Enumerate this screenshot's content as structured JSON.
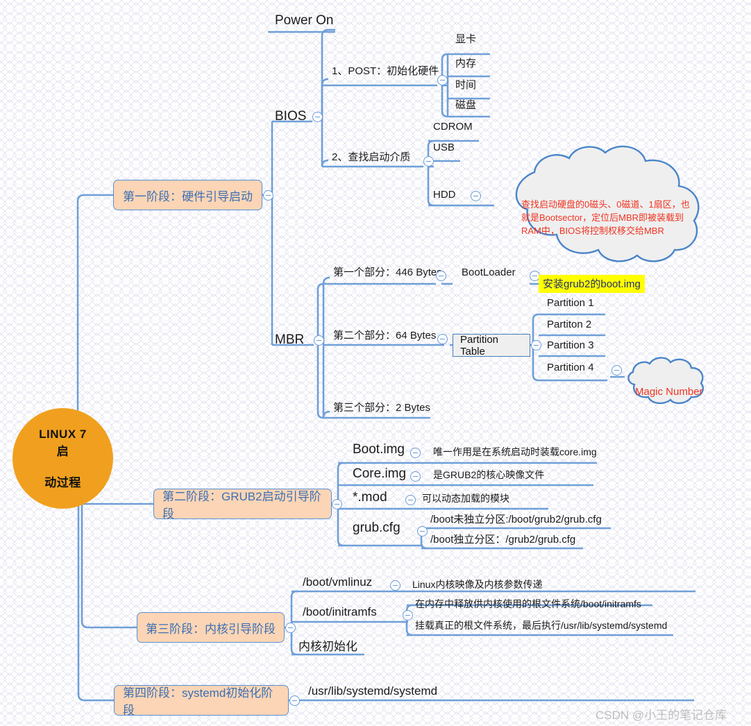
{
  "central": {
    "line1": "LINUX 7 启",
    "line2": "动过程"
  },
  "stages": [
    {
      "label": "第一阶段：硬件引导启动"
    },
    {
      "label": "第二阶段：GRUB2启动引导阶段"
    },
    {
      "label": "第三阶段：内核引导阶段"
    },
    {
      "label": "第四阶段：systemd初始化阶段"
    }
  ],
  "stage1": {
    "power_on": "Power On",
    "bios": "BIOS",
    "post": "1、POST：初始化硬件",
    "post_items": [
      "显卡",
      "内存",
      "时间",
      "磁盘"
    ],
    "find_media": "2、查找启动介质",
    "media_items": [
      "CDROM",
      "USB",
      "HDD"
    ],
    "hdd_cloud": "查找启动硬盘的0磁头、0磁道、1扇区，也\n就是Bootsector，定位后MBR即被装载到\nRAM中，BIOS将控制权移交给MBR"
  },
  "mbr": {
    "title": "MBR",
    "part1": "第一个部分：446 Bytes",
    "bootloader": "BootLoader",
    "bootloader_note": "安装grub2的boot.img",
    "part2": "第二个部分：64 Bytes",
    "partition_table": "Partition Table",
    "partitions": [
      "Partition 1",
      "Partiton 2",
      "Partition 3",
      "Partition 4"
    ],
    "magic_number": "Magic Number",
    "part3": "第三个部分：2 Bytes"
  },
  "grub2": {
    "items": [
      {
        "name": "Boot.img",
        "note": "唯一作用是在系统启动时装载core.img"
      },
      {
        "name": "Core.img",
        "note": "是GRUB2的核心映像文件"
      },
      {
        "name": "*.mod",
        "note": "可以动态加载的模块"
      },
      {
        "name": "grub.cfg",
        "note": ""
      }
    ],
    "grubcfg_subs": [
      "/boot未独立分区:/boot/grub2/grub.cfg",
      "/boot独立分区：/grub2/grub.cfg"
    ]
  },
  "kernel": {
    "vmlinuz": "/boot/vmlinuz",
    "vmlinuz_note": "Linux内核映像及内核参数传递",
    "initramfs": "/boot/initramfs",
    "initramfs_notes": [
      "在内存中释放供内核使用的根文件系统/boot/initramfs",
      "挂载真正的根文件系统，最后执行/usr/lib/systemd/systemd"
    ],
    "kernel_init": "内核初始化"
  },
  "systemd": {
    "path": "/usr/lib/systemd/systemd"
  },
  "watermark": "CSDN @小王的笔记仓库",
  "colors": {
    "branch": "#6f9fd8",
    "central_fill": "#f0a01e",
    "stage_fill": "#fbd5b5",
    "stage_border": "#5b8fd4",
    "stage_text": "#3c6fb5",
    "cloud_text": "#f03322",
    "highlight": "#ffff00"
  }
}
